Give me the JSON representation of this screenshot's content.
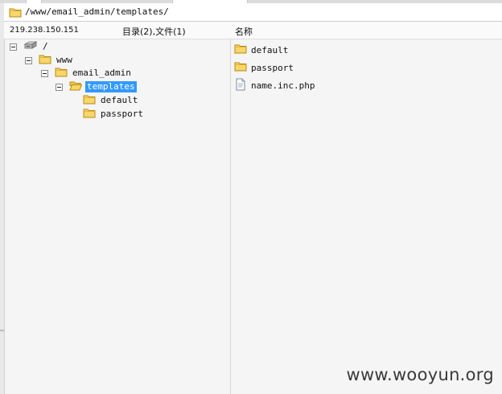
{
  "path_bar": {
    "path": "/www/email_admin/templates/"
  },
  "header": {
    "host_ip": "219.238.150.151",
    "summary": "目录(2),文件(1)",
    "name_column": "名称"
  },
  "tree": {
    "root": "/",
    "www": "www",
    "email_admin": "email_admin",
    "templates": "templates",
    "default": "default",
    "passport": "passport"
  },
  "files": [
    {
      "name": "default",
      "type": "folder"
    },
    {
      "name": "passport",
      "type": "folder"
    },
    {
      "name": "name.inc.php",
      "type": "file"
    }
  ],
  "watermark": "www.wooyun.org",
  "colors": {
    "selection": "#3399ff",
    "folder_fill": "#f7d769",
    "folder_stroke": "#b98a16"
  },
  "icons": {
    "folder": "folder-icon",
    "open_folder": "open-folder-icon",
    "drive": "drive-icon",
    "document": "document-icon",
    "collapse": "collapse-icon"
  }
}
